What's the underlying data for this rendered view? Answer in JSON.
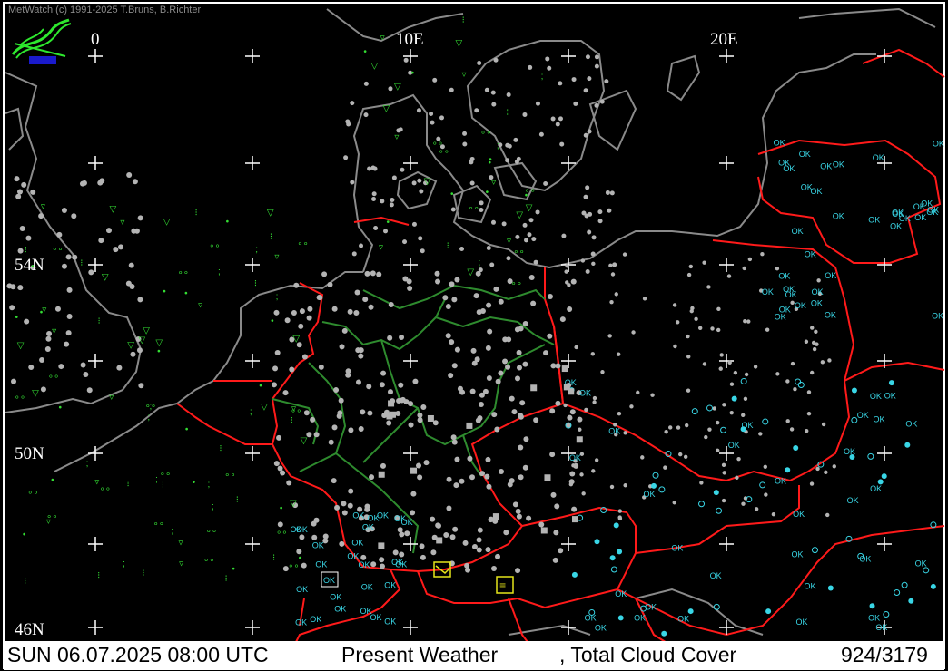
{
  "app": {
    "copyright": "MetWatch  (c) 1991-2025 T.Bruns, B.Richter"
  },
  "map": {
    "longitude_labels": [
      "0",
      "10E",
      "20E"
    ],
    "latitude_labels": [
      "54N",
      "50N",
      "46N"
    ],
    "colors": {
      "background": "#000000",
      "coastline": "#8a8a8a",
      "border_national": "#ff1a1a",
      "border_regional": "#2e8b2e",
      "obs_gray": "#b4b4b4",
      "obs_cyan": "#39d6e6",
      "obs_green": "#33dd33",
      "grid": "#ffffff"
    },
    "icons": [
      "logo-icon",
      "grid-cross-icon",
      "station-dot-icon",
      "cloud-cover-icon",
      "rain-shower-icon",
      "drizzle-icon",
      "fog-icon",
      "thunderstorm-icon"
    ]
  },
  "status": {
    "datetime": "SUN 06.07.2025 08:00 UTC",
    "product": "Present Weather",
    "overlay": ", Total Cloud Cover",
    "count": "924/3179"
  }
}
